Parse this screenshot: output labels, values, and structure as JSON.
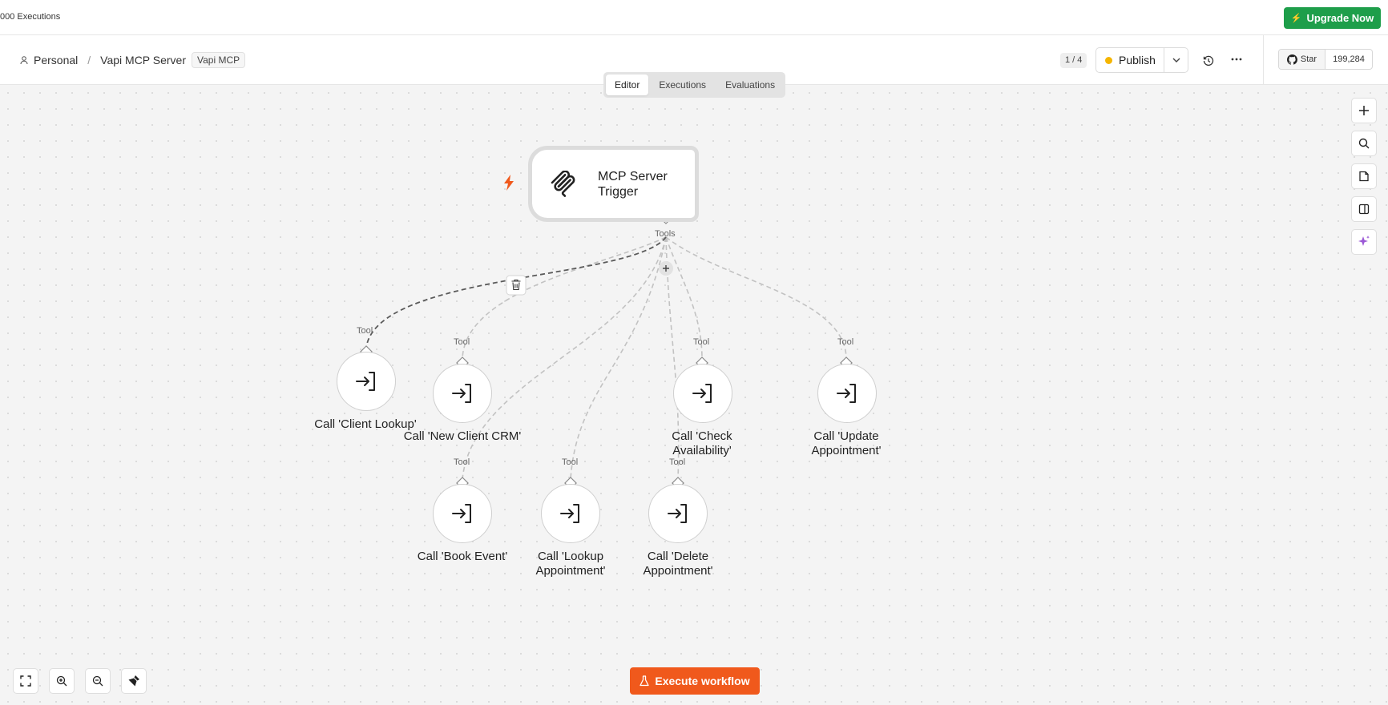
{
  "topbar": {
    "executions_text": "000 Executions",
    "upgrade_label": "Upgrade Now"
  },
  "header": {
    "breadcrumb_project": "Personal",
    "breadcrumb_sep": "/",
    "workflow_name": "Vapi MCP Server",
    "tag": "Vapi MCP",
    "version": "1 / 4",
    "publish_label": "Publish",
    "github_star_label": "Star",
    "github_star_count": "199,284"
  },
  "tabs": [
    "Editor",
    "Executions",
    "Evaluations"
  ],
  "trigger": {
    "label": "MCP Server Trigger",
    "port_label": "Tools"
  },
  "tool_port_label": "Tool",
  "nodes": [
    "Call 'Client Lookup'",
    "Call 'New Client CRM'",
    "Call 'Check Availability'",
    "Call 'Update Appointment'",
    "Call 'Book Event'",
    "Call 'Lookup Appointment'",
    "Call 'Delete Appointment'"
  ],
  "execute_label": "Execute workflow",
  "colors": {
    "upgrade": "#1e9e4a",
    "execute": "#f0591c",
    "publish_dot": "#f5b500",
    "ai_icon": "#9b59d6"
  }
}
